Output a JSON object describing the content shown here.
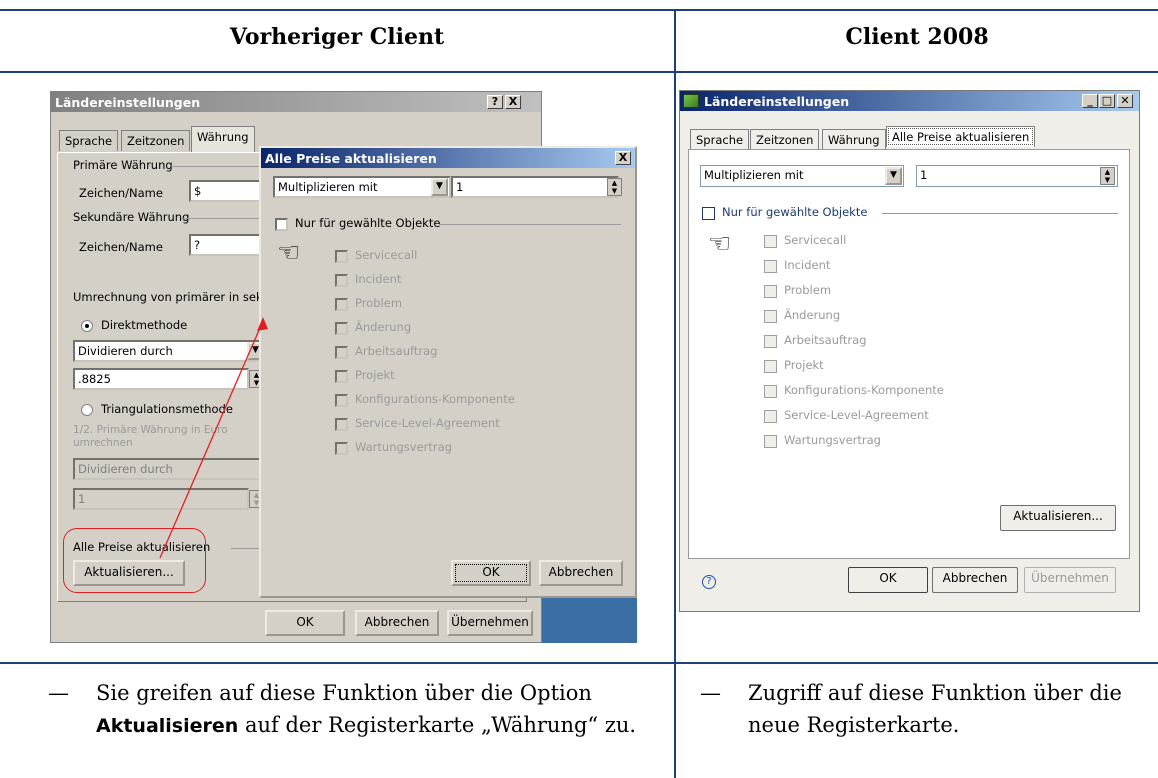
{
  "headers": {
    "left": "Vorheriger Client",
    "right": "Client 2008"
  },
  "old_ui": {
    "main_window": {
      "title": "Ländereinstellungen",
      "title_buttons": [
        "?",
        "X"
      ],
      "tabs": [
        "Sprache",
        "Zeitzonen",
        "Währung"
      ],
      "primary_group": "Primäre Währung",
      "sign_label": "Zeichen/Name",
      "primary_sign_value": "$",
      "secondary_group": "Sekundäre Währung",
      "secondary_sign_value": "?",
      "conversion_label": "Umrechnung von primärer in sekur",
      "direct_method": "Direktmethode",
      "direct_op": "Dividieren durch",
      "direct_value": ".8825",
      "triangulation_method": "Triangulationsmethode",
      "triangulation_note": "1/2. Primäre Währung in Euro umrechnen",
      "triangulation_op": "Dividieren durch",
      "triangulation_value": "1",
      "update_group": "Alle Preise aktualisieren",
      "update_button": "Aktualisieren...",
      "ok": "OK",
      "cancel": "Abbrechen",
      "apply": "Übernehmen"
    },
    "popup": {
      "title": "Alle Preise aktualisieren",
      "close": "X",
      "op": "Multiplizieren mit",
      "value": "1",
      "only_selected": "Nur für gewählte Objekte",
      "objects": [
        "Servicecall",
        "Incident",
        "Problem",
        "Änderung",
        "Arbeitsauftrag",
        "Projekt",
        "Konfigurations-Komponente",
        "Service-Level-Agreement",
        "Wartungsvertrag"
      ],
      "ok": "OK",
      "cancel": "Abbrechen"
    }
  },
  "new_ui": {
    "title": "Ländereinstellungen",
    "tabs": [
      "Sprache",
      "Zeitzonen",
      "Währung",
      "Alle Preise aktualisieren"
    ],
    "op": "Multiplizieren mit",
    "value": "1",
    "only_selected": "Nur für gewählte Objekte",
    "objects": [
      "Servicecall",
      "Incident",
      "Problem",
      "Änderung",
      "Arbeitsauftrag",
      "Projekt",
      "Konfigurations-Komponente",
      "Service-Level-Agreement",
      "Wartungsvertrag"
    ],
    "update_button": "Aktualisieren...",
    "help": "?",
    "ok": "OK",
    "cancel": "Abbrechen",
    "apply": "Übernehmen"
  },
  "notes": {
    "dash": "—",
    "left_before": "Sie greifen auf diese Funktion über die Option ",
    "left_bold": "Aktualisieren",
    "left_after": " auf der Registerkarte „Währung“ zu.",
    "right": "Zugriff auf diese Funktion über die neue Registerkarte."
  },
  "colors": {
    "rule": "#1f3f7a",
    "highlight": "#e02020",
    "title_active": "#0a246a",
    "title_inactive": "#808080"
  }
}
